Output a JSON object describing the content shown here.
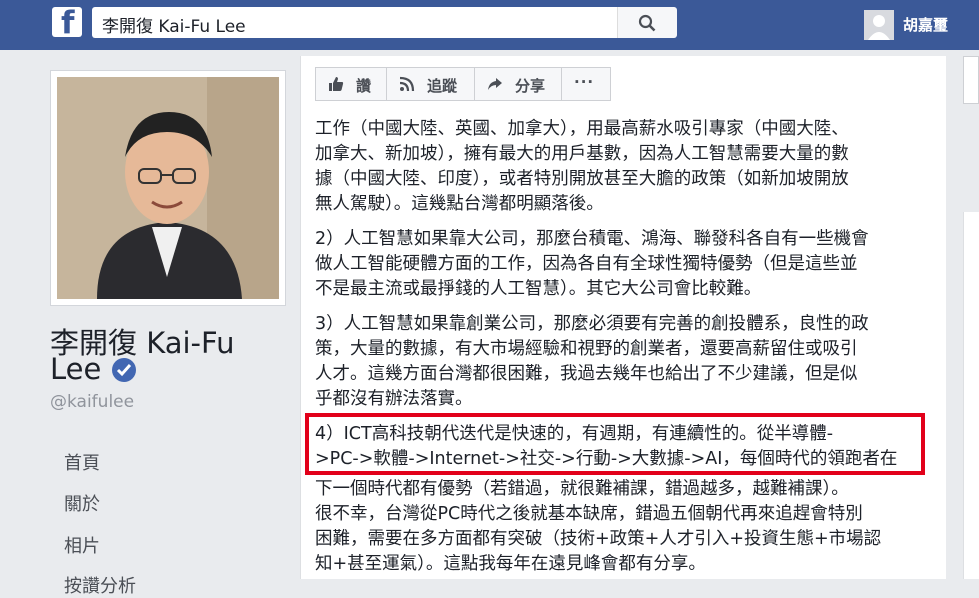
{
  "topbar": {
    "logo": "f",
    "search_value": "李開復 Kai-Fu Lee",
    "search_icon": "search-icon",
    "user_name": "胡嘉璽",
    "colors": {
      "bar": "#3b5998"
    }
  },
  "profile": {
    "name_line1": "李開復 Kai-Fu",
    "name_line2": "Lee",
    "handle": "@kaifulee",
    "verified_icon": "verified-badge-icon"
  },
  "nav": {
    "items": [
      "首頁",
      "關於",
      "相片",
      "按讚分析"
    ]
  },
  "post_actions": {
    "like": "讚",
    "follow": "追蹤",
    "share": "分享",
    "more": "···"
  },
  "post": {
    "paragraphs": [
      "工作（中國大陸、英國、加拿大），用最高薪水吸引專家（中國大陸、",
      "加拿大、新加坡），擁有最大的用戶基數，因為人工智慧需要大量的數",
      "據（中國大陸、印度），或者特別開放甚至大膽的政策（如新加坡開放",
      "無人駕駛）。這幾點台灣都明顯落後。",
      "2）人工智慧如果靠大公司，那麼台積電、鴻海、聯發科各自有一些機會",
      "做人工智能硬體方面的工作，因為各自有全球性獨特優勢（但是這些並",
      "不是最主流或最掙錢的人工智慧）。其它大公司會比較難。",
      "3）人工智慧如果靠創業公司，那麼必須要有完善的創投體系，良性的政",
      "策，大量的數據，有大市場經驗和視野的創業者，還要高薪留住或吸引",
      "人才。這幾方面台灣都很困難，我過去幾年也給出了不少建議，但是似",
      "乎都沒有辦法落實。",
      "4）ICT高科技朝代迭代是快速的，有週期，有連續性的。從半導體-",
      ">PC->軟體->Internet->社交->行動->大數據->AI，每個時代的領跑者在",
      "下一個時代都有優勢（若錯過，就很難補課，錯過越多，越難補課）。",
      "很不幸，台灣從PC時代之後就基本缺席，錯過五個朝代再來追趕會特別",
      "困難，需要在多方面都有突破（技術+政策+人才引入+投資生態+市場認",
      "知+甚至運氣）。這點我每年在遠見峰會都有分享。"
    ],
    "highlight_color": "#e2001a"
  }
}
